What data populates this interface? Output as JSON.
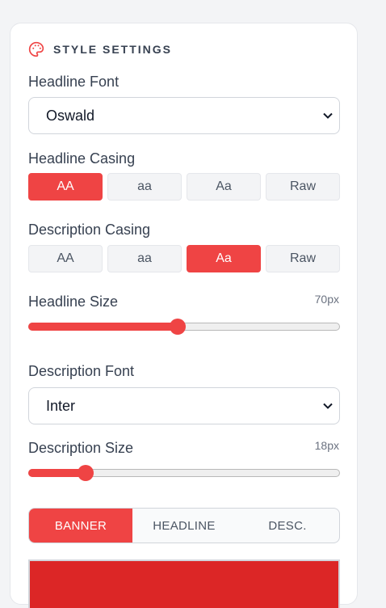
{
  "panel": {
    "title": "STYLE SETTINGS",
    "icon": "palette-icon"
  },
  "headline_font": {
    "label": "Headline Font",
    "value": "Oswald"
  },
  "headline_casing": {
    "label": "Headline Casing",
    "options": [
      "AA",
      "aa",
      "Aa",
      "Raw"
    ],
    "selected_index": 0
  },
  "description_casing": {
    "label": "Description Casing",
    "options": [
      "AA",
      "aa",
      "Aa",
      "Raw"
    ],
    "selected_index": 2
  },
  "headline_size": {
    "label": "Headline Size",
    "value_text": "70px",
    "level_fraction": 0.48
  },
  "description_font": {
    "label": "Description Font",
    "value": "Inter"
  },
  "description_size": {
    "label": "Description Size",
    "value_text": "18px",
    "level_fraction": 0.185
  },
  "color_tabs": {
    "options": [
      "BANNER",
      "HEADLINE",
      "DESC."
    ],
    "selected_index": 0
  },
  "colors": {
    "accent": "#ef4444",
    "preview": "#dc2626"
  }
}
